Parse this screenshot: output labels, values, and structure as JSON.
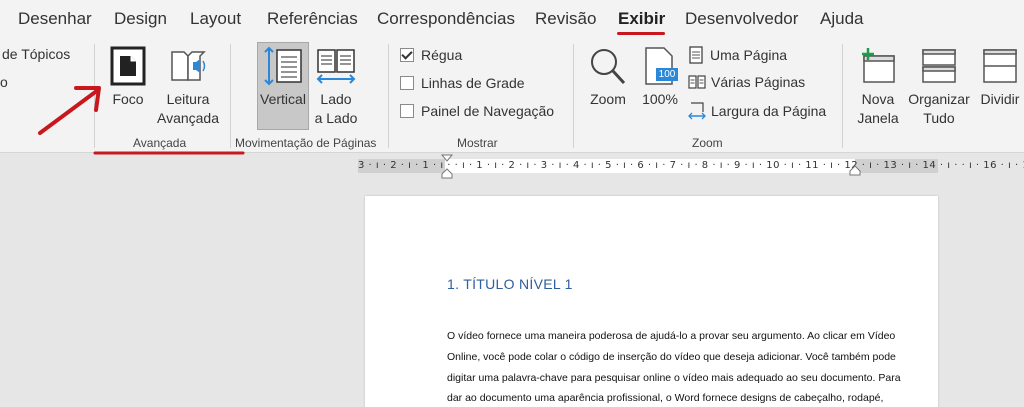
{
  "tabs": [
    "Desenhar",
    "Design",
    "Layout",
    "Referências",
    "Correspondências",
    "Revisão",
    "Exibir",
    "Desenvolvedor",
    "Ajuda"
  ],
  "active_tab": "Exibir",
  "left_cut": {
    "item1": "de Tópicos",
    "item2": "o"
  },
  "groups": {
    "avancada": {
      "label": "Avançada",
      "foco": "Foco",
      "leitura_line1": "Leitura",
      "leitura_line2": "Avançada"
    },
    "movimentacao": {
      "label": "Movimentação de Páginas",
      "vertical": "Vertical",
      "lado_line1": "Lado",
      "lado_line2": "a Lado"
    },
    "mostrar": {
      "label": "Mostrar",
      "regua": "Régua",
      "regua_checked": true,
      "linhas": "Linhas de Grade",
      "painel": "Painel de Navegação"
    },
    "zoom": {
      "label": "Zoom",
      "zoom": "Zoom",
      "pct": "100%",
      "icon_num": "100",
      "uma": "Uma Página",
      "varias": "Várias Páginas",
      "largura": "Largura da Página"
    },
    "janela": {
      "nova_line1": "Nova",
      "nova_line2": "Janela",
      "organizar_line1": "Organizar",
      "organizar_line2": "Tudo",
      "dividir": "Dividir"
    }
  },
  "ruler": "3 · ı · 2 · ı · 1 · ı ·   · ı · 1 · ı · 2 · ı · 3 · ı · 4 · ı · 5 · ı · 6 · ı · 7 · ı · 8 · ı · 9 · ı · 10 · ı · 11 · ı · 12 · ı · 13 · ı · 14 · ı ·   · ı · 16 · ı · 17 · ı ·",
  "document": {
    "heading": "1.  TÍTULO NÍVEL 1",
    "lines": [
      "O vídeo fornece uma maneira poderosa de ajudá-lo a provar seu argumento. Ao clicar em Vídeo",
      "Online, você pode colar o código de inserção do vídeo que deseja adicionar. Você também pode",
      "digitar uma palavra-chave para pesquisar online o vídeo mais adequado ao seu documento. Para",
      "dar ao documento uma aparência profissional, o Word fornece designs de cabeçalho, rodapé,"
    ]
  },
  "colors": {
    "annotation_red": "#c8181e",
    "heading_blue": "#2f5e9e",
    "accent_blue": "#2b88d8"
  }
}
